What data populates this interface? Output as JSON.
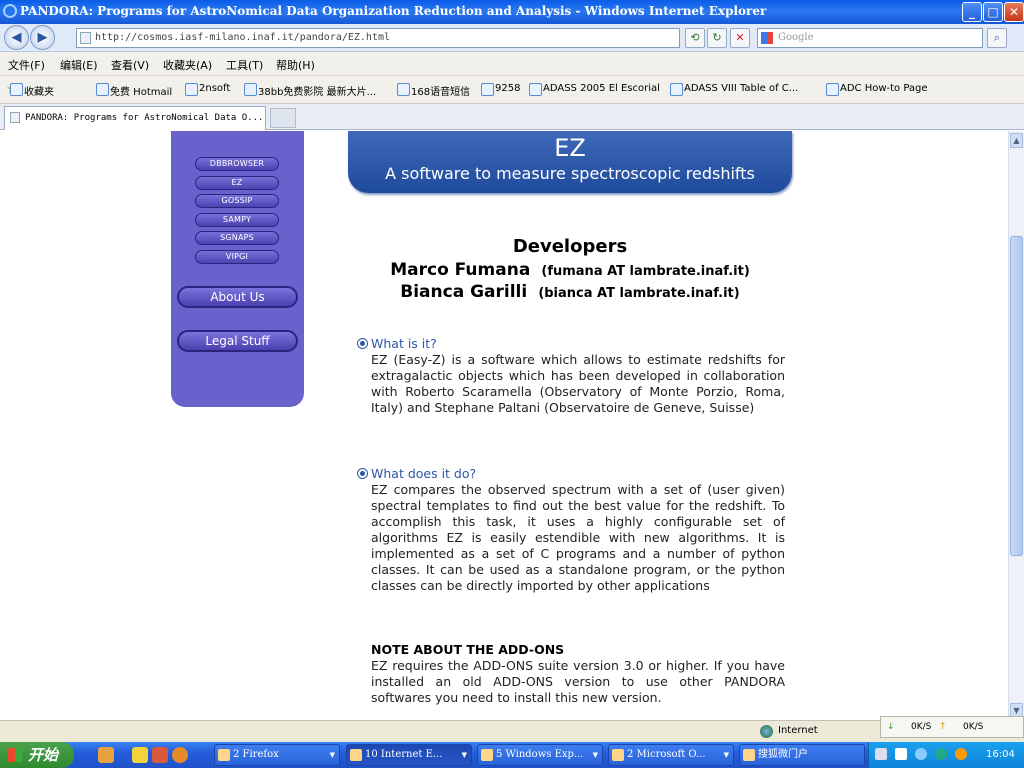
{
  "window": {
    "title": "PANDORA: Programs for AstroNomical Data Organization Reduction and Analysis - Windows Internet Explorer",
    "min": "_",
    "max": "□",
    "close": "✕"
  },
  "navbar": {
    "back": "◀",
    "forward": "▶",
    "address": "http://cosmos.iasf-milano.inaf.it/pandora/EZ.html",
    "search_placeholder": "Google"
  },
  "menu": [
    "文件(F)",
    "编辑(E)",
    "查看(V)",
    "收藏夹(A)",
    "工具(T)",
    "帮助(H)"
  ],
  "favorites": {
    "label": "收藏夹",
    "items": [
      "免费 Hotmail",
      "2nsoft",
      "38bb免费影院 最新大片...",
      "168语音短信",
      "9258",
      "ADASS 2005 El Escorial",
      "ADASS VIII Table of C...",
      "ADC How-to Page"
    ]
  },
  "tab": {
    "title": "PANDORA: Programs for AstroNomical Data O..."
  },
  "sidebar": {
    "items": [
      "DBBROWSER",
      "EZ",
      "GOSSIP",
      "SAMPY",
      "SGNAPS",
      "VIPGI"
    ],
    "about": "About Us",
    "legal": "Legal Stuff"
  },
  "banner": {
    "title": "EZ",
    "subtitle": "A software to measure spectroscopic redshifts"
  },
  "developers": {
    "heading": "Developers",
    "people": [
      {
        "name": "Marco Fumana",
        "email": "(fumana AT lambrate.inaf.it)"
      },
      {
        "name": "Bianca Garilli",
        "email": "(bianca AT lambrate.inaf.it)"
      }
    ]
  },
  "sections": {
    "what_is": {
      "title": "What is it?",
      "body": "EZ (Easy-Z) is a software which allows to estimate redshifts for extragalactic objects which has been developed in collaboration with Roberto Scaramella (Observatory of Monte Porzio, Roma, Italy) and Stephane Paltani (Observatoire de Geneve, Suisse)"
    },
    "what_does": {
      "title": "What does it do?",
      "body": "EZ compares the observed spectrum with a set of (user given) spectral templates to find out the best value for the redshift. To accomplish this task, it uses a highly configurable set of algorithms EZ is easily estendible with new algorithms. It is implemented as a set of C programs and a number of python classes. It can be used as a standalone program, or the python classes can be directly imported by other applications"
    },
    "note": {
      "title": "NOTE ABOUT THE ADD-ONS",
      "body": "EZ requires the ADD-ONS suite version 3.0 or higher. If you have installed an old ADD-ONS version to use other PANDORA softwares you need to install this new version."
    }
  },
  "status": {
    "zone": "Internet",
    "down": "0K/S",
    "up": "0K/S"
  },
  "taskbar": {
    "start": "开始",
    "buttons": [
      "2 Firefox",
      "10 Internet E...",
      "5 Windows Exp...",
      "2 Microsoft O...",
      "搜狐微门户"
    ],
    "clock": "16:04"
  }
}
